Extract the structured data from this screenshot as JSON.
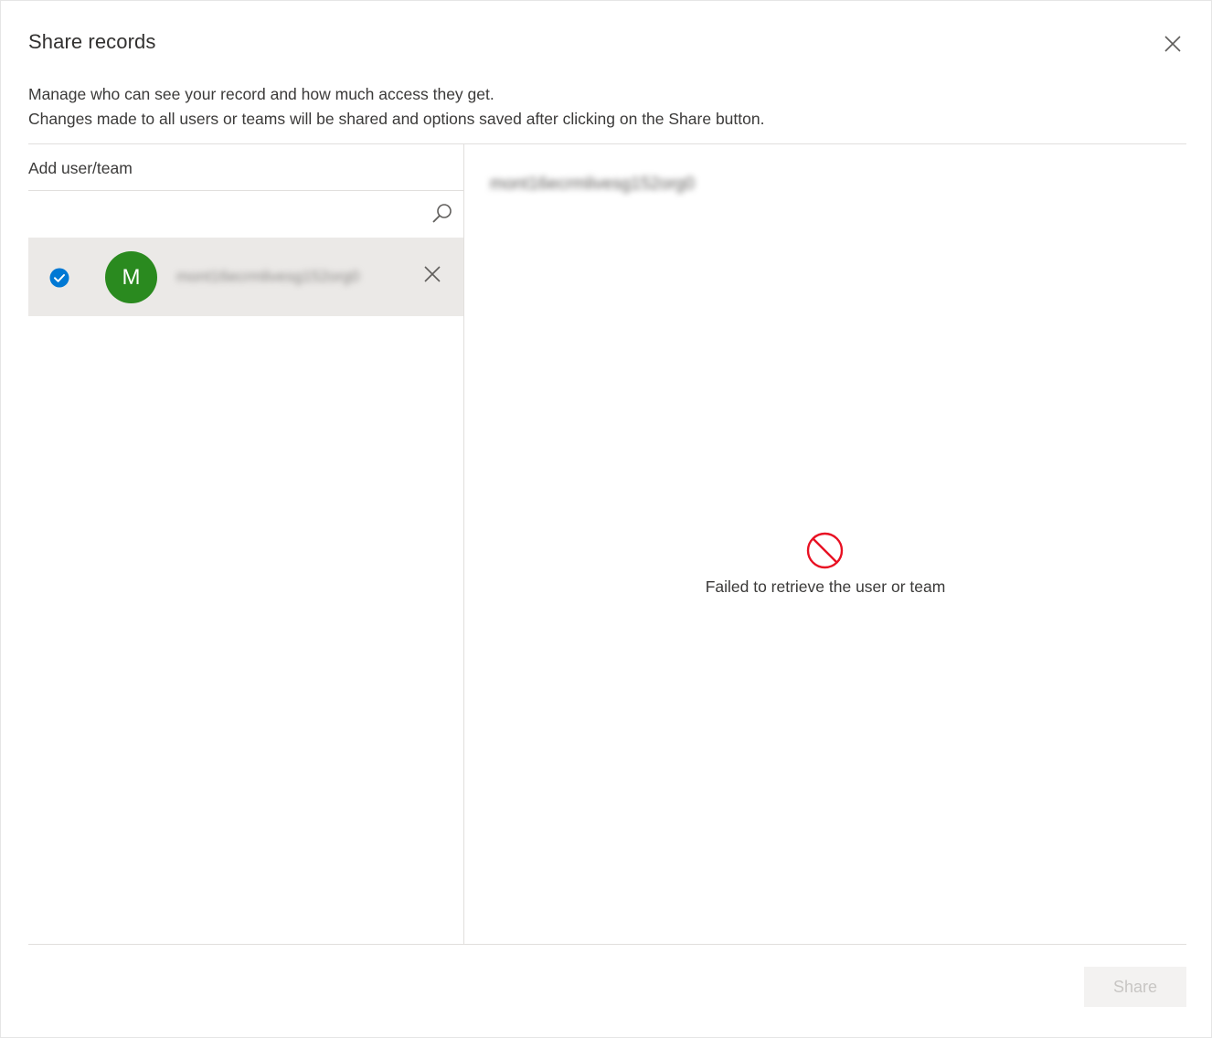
{
  "dialog": {
    "title": "Share records",
    "close_label": "Close",
    "description_line1": "Manage who can see your record and how much access they get.",
    "description_line2": "Changes made to all users or teams will be shared and options saved after clicking on the Share button."
  },
  "left": {
    "add_label": "Add user/team",
    "search_value": "",
    "search_icon": "search-icon",
    "users": [
      {
        "initial": "M",
        "name": "mont16ecrmlivesg152org0",
        "selected": true,
        "avatar_color": "#2a8a1f"
      }
    ]
  },
  "right": {
    "selected_name": "mont16ecrmlivesg152org0",
    "error_icon": "blocked-icon",
    "error_color": "#e81123",
    "error_message": "Failed to retrieve the user or team"
  },
  "footer": {
    "share_label": "Share",
    "share_enabled": false
  },
  "colors": {
    "accent": "#0078d4",
    "divider": "#e1dfdd",
    "selected_row": "#ebe9e7"
  }
}
